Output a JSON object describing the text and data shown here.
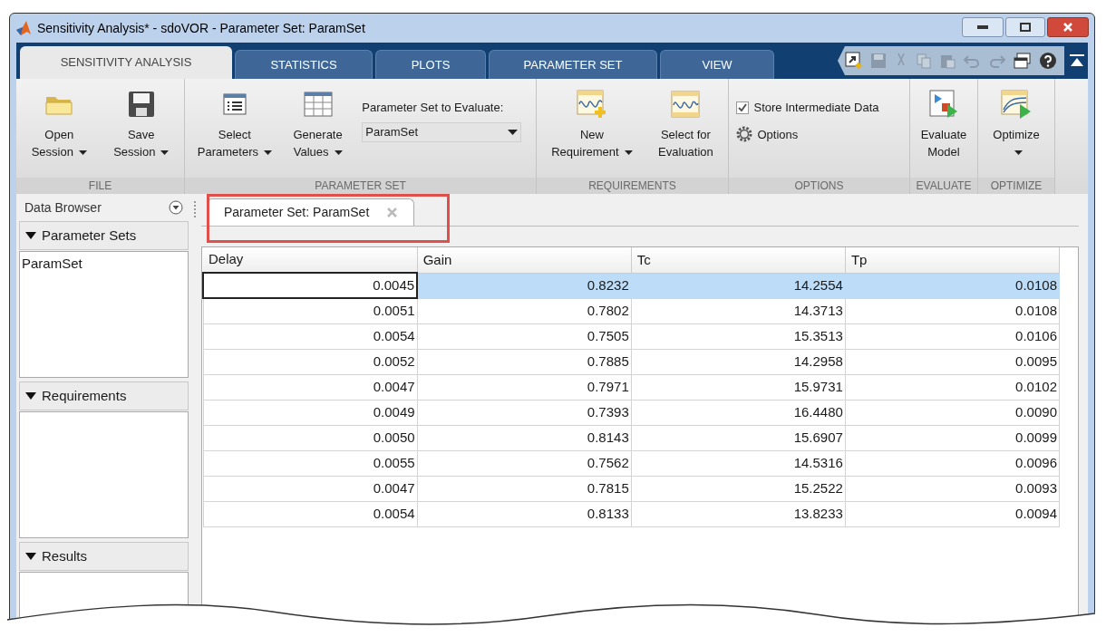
{
  "window": {
    "title": "Sensitivity Analysis* - sdoVOR - Parameter Set:  ParamSet"
  },
  "tabs": [
    {
      "label": "SENSITIVITY ANALYSIS",
      "selected": true
    },
    {
      "label": "STATISTICS",
      "selected": false
    },
    {
      "label": "PLOTS",
      "selected": false
    },
    {
      "label": "PARAMETER SET",
      "selected": false
    },
    {
      "label": "VIEW",
      "selected": false
    }
  ],
  "ribbon": [
    {
      "label": "FILE",
      "items": [
        {
          "kind": "button",
          "lines": [
            "Open",
            "Session"
          ],
          "dropdown": true
        },
        {
          "kind": "button",
          "lines": [
            "Save",
            "Session"
          ],
          "dropdown": true
        }
      ]
    },
    {
      "label": "PARAMETER SET",
      "items": [
        {
          "kind": "button",
          "lines": [
            "Select",
            "Parameters"
          ],
          "dropdown": true
        },
        {
          "kind": "button",
          "lines": [
            "Generate",
            "Values"
          ],
          "dropdown": true
        },
        {
          "kind": "select",
          "label": "Parameter Set to Evaluate:",
          "value": "ParamSet"
        }
      ]
    },
    {
      "label": "REQUIREMENTS",
      "items": [
        {
          "kind": "button",
          "lines": [
            "New",
            "Requirement"
          ],
          "dropdown": true
        },
        {
          "kind": "button",
          "lines": [
            "Select for",
            "Evaluation"
          ],
          "dropdown": false
        }
      ]
    },
    {
      "label": "OPTIONS",
      "items": [
        {
          "kind": "options",
          "checkbox": {
            "label": "Store Intermediate Data",
            "checked": true
          },
          "button": "Options"
        }
      ]
    },
    {
      "label": "EVALUATE",
      "items": [
        {
          "kind": "button",
          "lines": [
            "Evaluate",
            "Model"
          ],
          "dropdown": false
        }
      ]
    },
    {
      "label": "OPTIMIZE",
      "items": [
        {
          "kind": "button",
          "lines": [
            "Optimize"
          ],
          "dropdown": true
        }
      ]
    }
  ],
  "data_browser": {
    "title": "Data Browser",
    "sections": [
      {
        "title": "Parameter Sets",
        "expanded": true,
        "items": [
          "ParamSet"
        ]
      },
      {
        "title": "Requirements",
        "expanded": true
      },
      {
        "title": "Results",
        "expanded": true
      }
    ]
  },
  "document_tab": {
    "label": "Parameter Set:  ParamSet"
  },
  "table": {
    "columns": [
      "Delay",
      "Gain",
      "Tc",
      "Tp"
    ],
    "rows": [
      {
        "cells": [
          "0.0045",
          "0.8232",
          "14.2554",
          "0.0108"
        ],
        "selected": true
      },
      {
        "cells": [
          "0.0051",
          "0.7802",
          "14.3713",
          "0.0108"
        ],
        "selected": false
      },
      {
        "cells": [
          "0.0054",
          "0.7505",
          "15.3513",
          "0.0106"
        ],
        "selected": false
      },
      {
        "cells": [
          "0.0052",
          "0.7885",
          "14.2958",
          "0.0095"
        ],
        "selected": false
      },
      {
        "cells": [
          "0.0047",
          "0.7971",
          "15.9731",
          "0.0102"
        ],
        "selected": false
      },
      {
        "cells": [
          "0.0049",
          "0.7393",
          "16.4480",
          "0.0090"
        ],
        "selected": false
      },
      {
        "cells": [
          "0.0050",
          "0.8143",
          "15.6907",
          "0.0099"
        ],
        "selected": false
      },
      {
        "cells": [
          "0.0055",
          "0.7562",
          "14.5316",
          "0.0096"
        ],
        "selected": false
      },
      {
        "cells": [
          "0.0047",
          "0.7815",
          "15.2522",
          "0.0093"
        ],
        "selected": false
      },
      {
        "cells": [
          "0.0054",
          "0.8133",
          "13.8233",
          "0.0094"
        ],
        "selected": false
      }
    ]
  }
}
